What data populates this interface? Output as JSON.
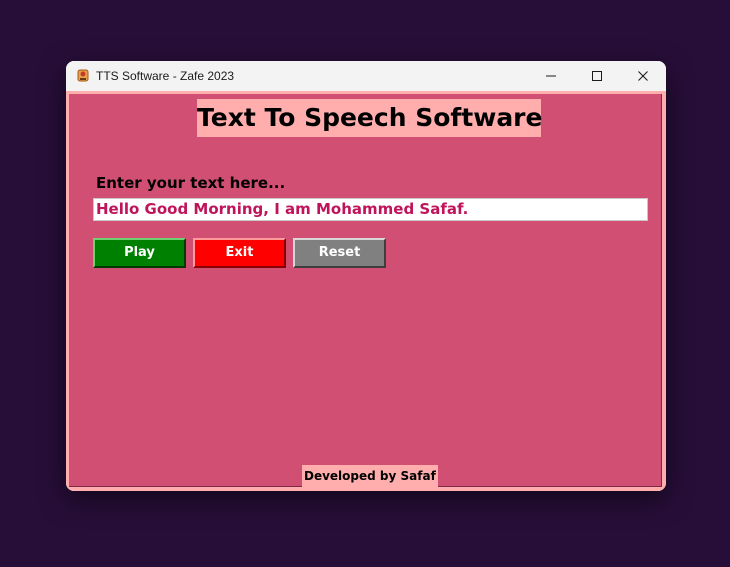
{
  "window": {
    "title": "TTS Software - Zafe 2023",
    "icon": "speaker-app-icon"
  },
  "title_controls": {
    "minimize_icon": "minimize-icon",
    "maximize_icon": "maximize-icon",
    "close_icon": "close-icon"
  },
  "app": {
    "heading": "Text To Speech Software",
    "prompt_label": "Enter your text here...",
    "input_value": "Hello Good Morning, I am Mohammed Safaf.",
    "buttons": {
      "play": "Play",
      "exit": "Exit",
      "reset": "Reset"
    },
    "footer": "Developed by Safaf"
  },
  "colors": {
    "desktop": "#270e38",
    "client_bg": "#d04f73",
    "accent_pink": "#ffadad",
    "input_text": "#c0145a",
    "play": "#008000",
    "exit": "#ff0000",
    "reset": "#808080"
  }
}
